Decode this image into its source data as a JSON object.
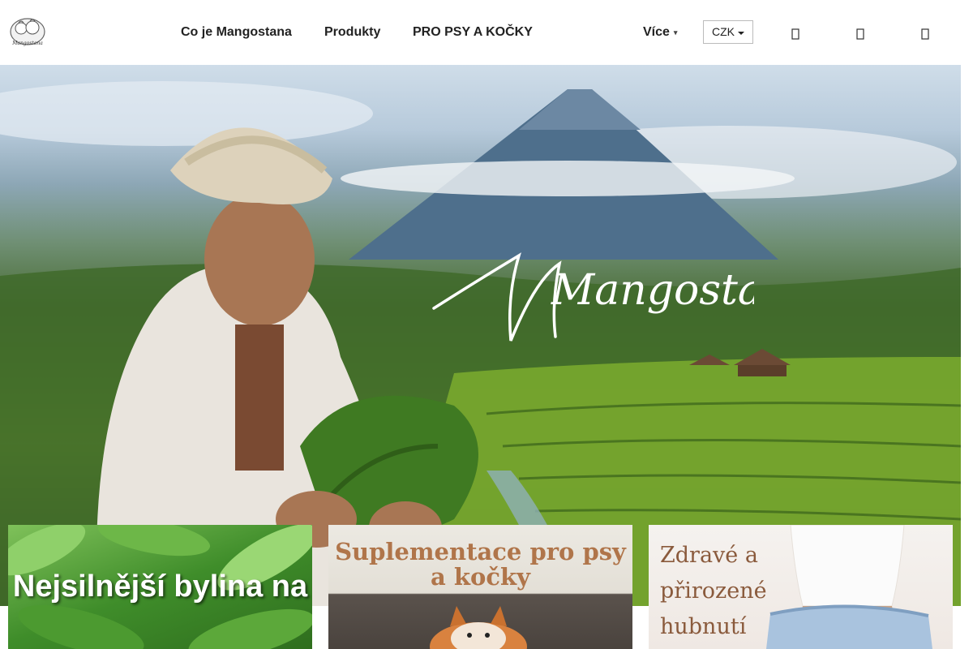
{
  "header": {
    "logo_text": "Mangostana",
    "nav": [
      "Co je Mangostana",
      "Produkty",
      "PRO PSY A KOČKY"
    ],
    "more_label": "Více",
    "currency": "CZK",
    "icons": [
      "search-icon",
      "user-icon",
      "cart-icon"
    ]
  },
  "hero": {
    "logo_text": "Mangostana"
  },
  "cards": [
    {
      "title": "Nejsilnější bylina na"
    },
    {
      "title": "Suplementace pro psy a kočky"
    },
    {
      "title": "Zdravé a přirozené hubnutí"
    }
  ]
}
